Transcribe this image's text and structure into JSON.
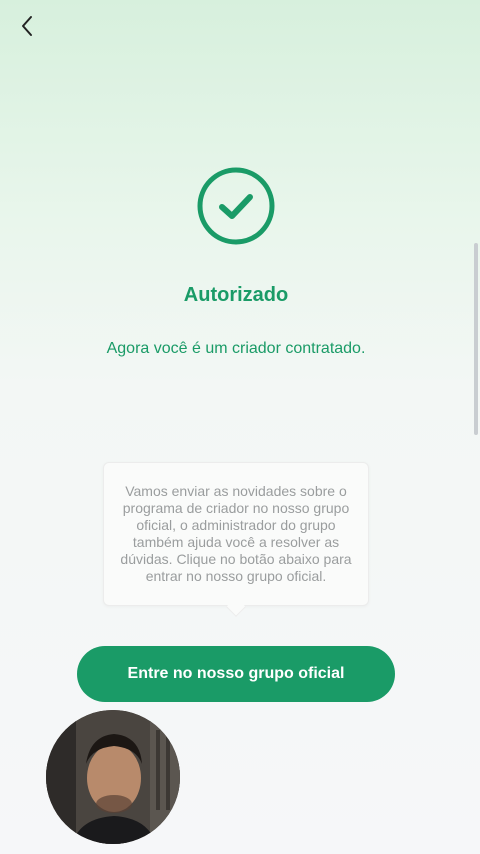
{
  "header": {
    "back_icon": "chevron-left-icon"
  },
  "status": {
    "icon": "check-circle-icon",
    "title": "Autorizado",
    "subtitle": "Agora você é um criador contratado."
  },
  "info": {
    "text": "Vamos enviar as novidades sobre o programa de criador no nosso grupo oficial, o administrador do grupo também ajuda você a resolver as dúvidas. Clique no botão abaixo para entrar no nosso grupo oficial."
  },
  "cta": {
    "label": "Entre no nosso grupo oficial"
  },
  "colors": {
    "accent": "#1a9b67",
    "card_text": "#9a9d9e"
  }
}
